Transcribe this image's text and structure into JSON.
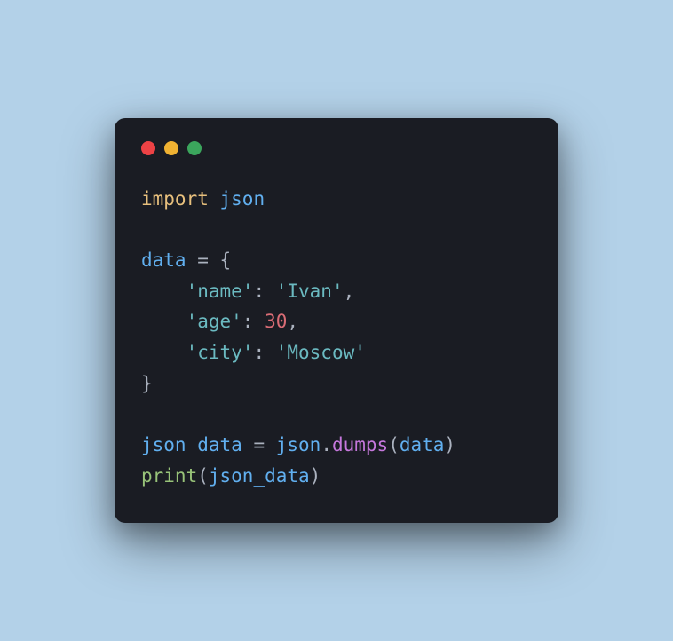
{
  "code": {
    "line1": {
      "import": "import",
      "module": "json"
    },
    "line3": {
      "var": "data",
      "eq": " = ",
      "brace": "{"
    },
    "line4": {
      "indent": "    ",
      "key": "'name'",
      "colon": ": ",
      "value": "'Ivan'",
      "comma": ","
    },
    "line5": {
      "indent": "    ",
      "key": "'age'",
      "colon": ": ",
      "value": "30",
      "comma": ","
    },
    "line6": {
      "indent": "    ",
      "key": "'city'",
      "colon": ": ",
      "value": "'Moscow'"
    },
    "line7": {
      "brace": "}"
    },
    "line9": {
      "var": "json_data",
      "eq": " = ",
      "obj": "json",
      "dot": ".",
      "func": "dumps",
      "lparen": "(",
      "arg": "data",
      "rparen": ")"
    },
    "line10": {
      "func": "print",
      "lparen": "(",
      "arg": "json_data",
      "rparen": ")"
    }
  }
}
